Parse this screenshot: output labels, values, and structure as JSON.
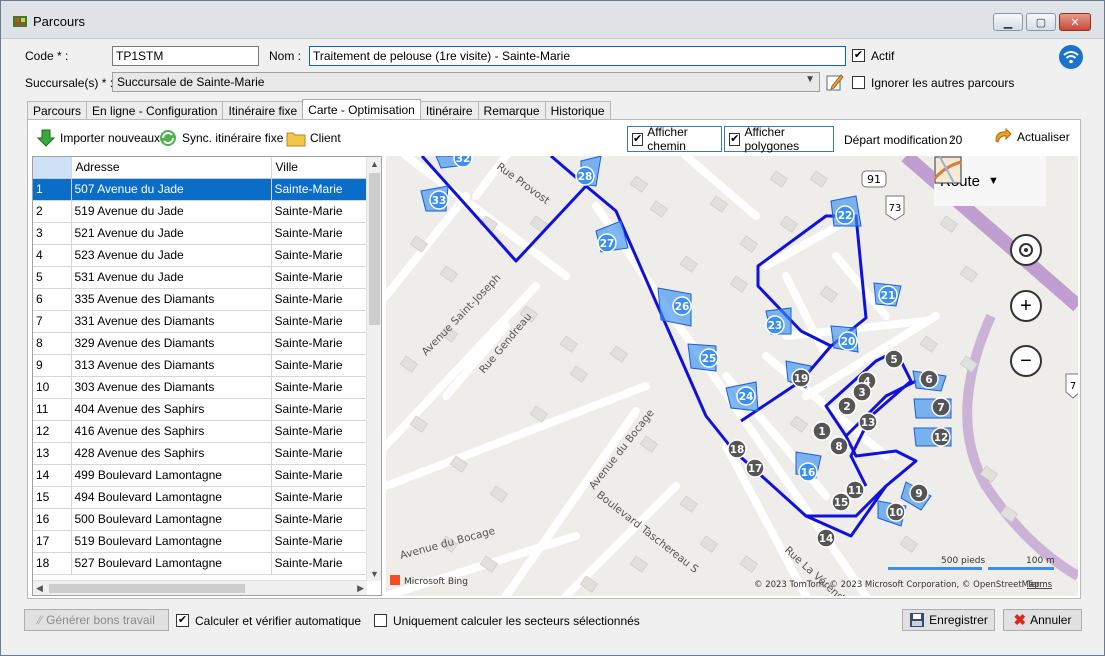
{
  "window": {
    "title": "Parcours"
  },
  "form": {
    "code_label": "Code * :",
    "code_value": "TP1STM",
    "nom_label": "Nom :",
    "nom_value": "Traitement de pelouse (1re visite) - Sainte-Marie",
    "actif_label": "Actif",
    "actif_checked": true,
    "succursale_label": "Succursale(s) * :",
    "succursale_value": "Succursale de Sainte-Marie",
    "ignorer_label": "Ignorer les autres parcours",
    "ignorer_checked": false
  },
  "tabs": [
    {
      "label": "Parcours",
      "active": false
    },
    {
      "label": "En ligne - Configuration",
      "active": false
    },
    {
      "label": "Itinéraire fixe",
      "active": false
    },
    {
      "label": "Carte - Optimisation",
      "active": true
    },
    {
      "label": "Itinéraire",
      "active": false
    },
    {
      "label": "Remarque",
      "active": false
    },
    {
      "label": "Historique",
      "active": false
    }
  ],
  "toolbar": {
    "importer": "Importer nouveaux",
    "sync": "Sync. itinéraire fixe",
    "client": "Client",
    "afficher_chemin": "Afficher chemin",
    "afficher_polygones": "Afficher polygones",
    "depart_label": "Départ modification :",
    "depart_value": "20",
    "actualiser": "Actualiser"
  },
  "grid": {
    "headers": [
      "",
      "Adresse",
      "Ville"
    ],
    "rows": [
      [
        "1",
        "507 Avenue du Jade",
        "Sainte-Marie"
      ],
      [
        "2",
        "519 Avenue du Jade",
        "Sainte-Marie"
      ],
      [
        "3",
        "521 Avenue du Jade",
        "Sainte-Marie"
      ],
      [
        "4",
        "523 Avenue du Jade",
        "Sainte-Marie"
      ],
      [
        "5",
        "531 Avenue du Jade",
        "Sainte-Marie"
      ],
      [
        "6",
        "335 Avenue des Diamants",
        "Sainte-Marie"
      ],
      [
        "7",
        "331 Avenue des Diamants",
        "Sainte-Marie"
      ],
      [
        "8",
        "329 Avenue des Diamants",
        "Sainte-Marie"
      ],
      [
        "9",
        "313 Avenue des Diamants",
        "Sainte-Marie"
      ],
      [
        "10",
        "303 Avenue des Diamants",
        "Sainte-Marie"
      ],
      [
        "11",
        "404 Avenue des Saphirs",
        "Sainte-Marie"
      ],
      [
        "12",
        "416 Avenue des Saphirs",
        "Sainte-Marie"
      ],
      [
        "13",
        "428 Avenue des Saphirs",
        "Sainte-Marie"
      ],
      [
        "14",
        "499 Boulevard Lamontagne",
        "Sainte-Marie"
      ],
      [
        "15",
        "494 Boulevard Lamontagne",
        "Sainte-Marie"
      ],
      [
        "16",
        "500 Boulevard Lamontagne",
        "Sainte-Marie"
      ],
      [
        "17",
        "519 Boulevard Lamontagne",
        "Sainte-Marie"
      ],
      [
        "18",
        "527 Boulevard Lamontagne",
        "Sainte-Marie"
      ]
    ],
    "selected_row": 0
  },
  "map": {
    "style_label": "Route",
    "streets": [
      "Rue Provost",
      "Avenue Saint-Joseph",
      "Rue Gendreau",
      "Avenue du Bocage",
      "Boulevard Taschereau S",
      "Avenue du Bocage",
      "Rue La Vérendrye"
    ],
    "highway_labels": [
      "91",
      "73",
      "7"
    ],
    "scale_pieds": "500 pieds",
    "scale_m": "100 m",
    "provider": "Microsoft Bing",
    "copyright": "© 2023 TomTom, © 2023 Microsoft Corporation, © OpenStreetMap",
    "terms": "Terms",
    "blue_markers": [
      "32",
      "33",
      "28",
      "27",
      "26",
      "25",
      "24",
      "22",
      "21",
      "23",
      "20",
      "16"
    ],
    "dark_markers": [
      "19",
      "5",
      "6",
      "4",
      "3",
      "2",
      "7",
      "13",
      "1",
      "12",
      "8",
      "18",
      "17",
      "11",
      "9",
      "15",
      "10",
      "14"
    ]
  },
  "footer": {
    "generer": "Générer bons travail",
    "calculer_label": "Calculer et vérifier automatique",
    "calculer_checked": true,
    "uniquement_label": "Uniquement calculer les secteurs sélectionnés",
    "uniquement_checked": false,
    "enregistrer": "Enregistrer",
    "annuler": "Annuler"
  },
  "colors": {
    "selection": "#0a6ec8",
    "route": "#1111dd",
    "polygon": "#3a8ff0",
    "marker_dark": "#555555"
  }
}
